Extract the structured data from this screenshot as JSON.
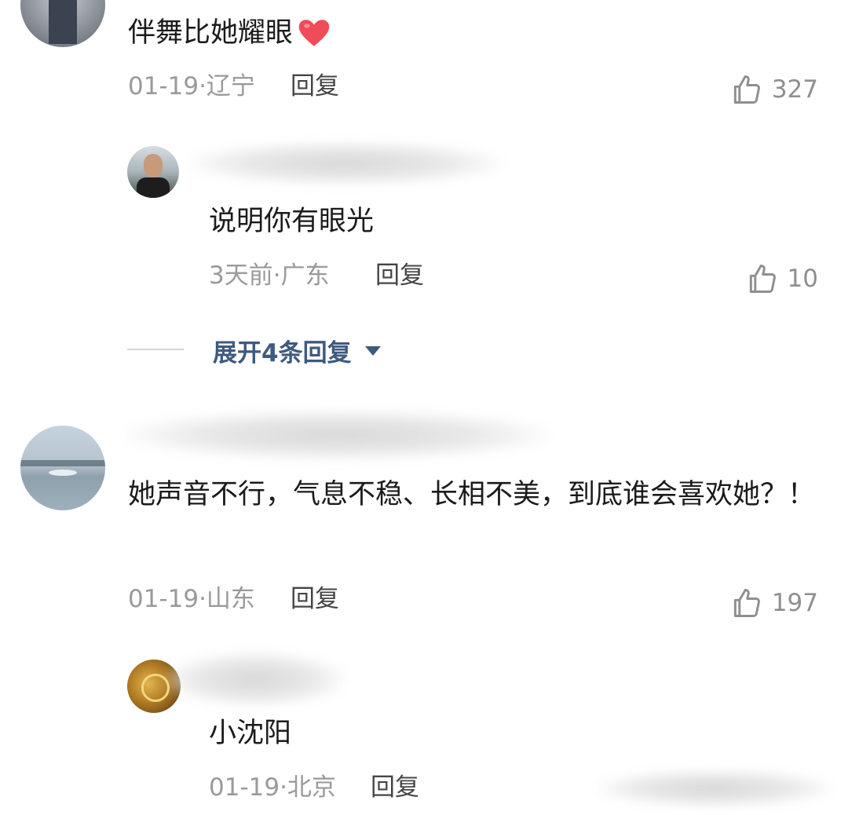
{
  "colors": {
    "text": "#1b1b1b",
    "meta": "#9a9a9a",
    "reply": "#454545",
    "link": "#3e5a7f",
    "heart": "#f04b59"
  },
  "comments": [
    {
      "text": "伴舞比她耀眼",
      "emoji_icon": "red-heart-icon",
      "meta": "01-19·辽宁",
      "reply_label": "回复",
      "likes": "327"
    },
    {
      "text": "说明你有眼光",
      "meta": "3天前·广东",
      "reply_label": "回复",
      "likes": "10"
    },
    {
      "text": "她声音不行，气息不稳、长相不美，到底谁会喜欢她？！",
      "meta": "01-19·山东",
      "reply_label": "回复",
      "likes": "197"
    },
    {
      "text": "小沈阳",
      "meta": "01-19·北京",
      "reply_label": "回复"
    }
  ],
  "expand_replies": {
    "label": "展开4条回复",
    "icon": "caret-down-icon"
  },
  "icons": {
    "like": "thumbs-up-icon"
  }
}
